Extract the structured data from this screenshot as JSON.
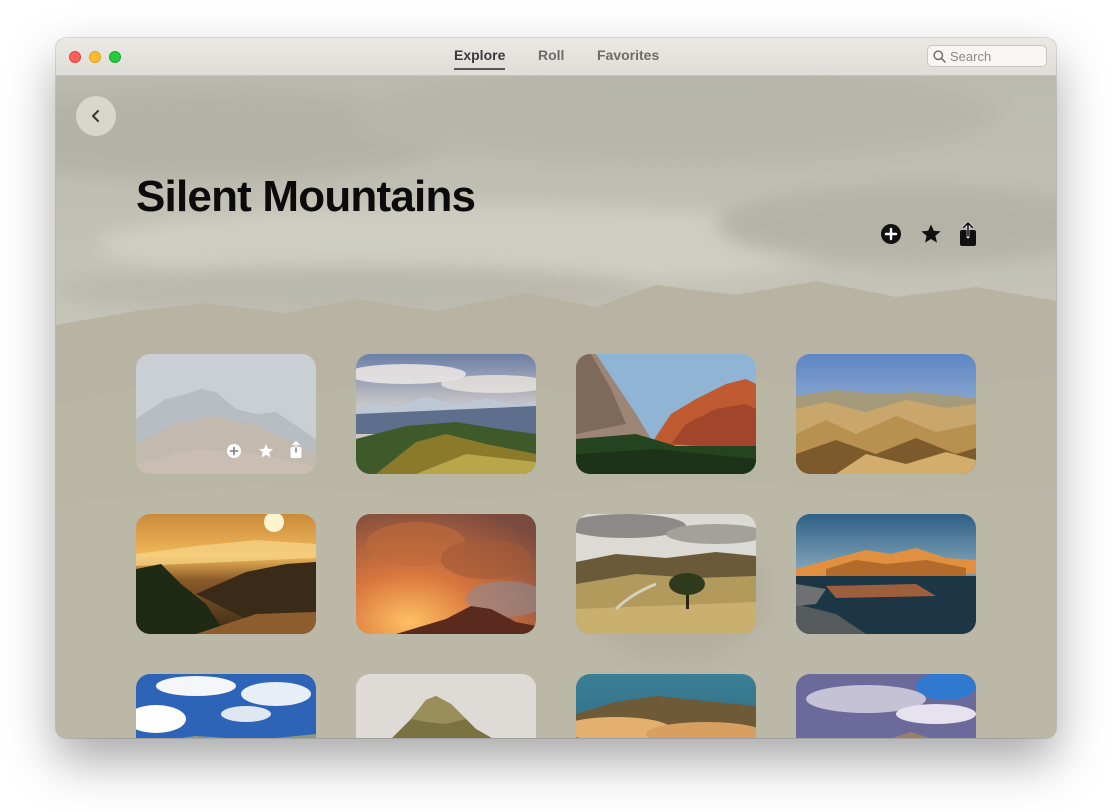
{
  "window": {
    "tabs": [
      {
        "label": "Explore",
        "active": true
      },
      {
        "label": "Roll",
        "active": false
      },
      {
        "label": "Favorites",
        "active": false
      }
    ],
    "search": {
      "placeholder": "Search",
      "value": ""
    }
  },
  "page": {
    "title": "Silent Mountains",
    "actions": [
      {
        "name": "add",
        "icon": "plus-circle-icon"
      },
      {
        "name": "favorite",
        "icon": "star-icon"
      },
      {
        "name": "share",
        "icon": "share-icon"
      }
    ]
  },
  "grid": {
    "hovered_index": 0,
    "hover_actions": [
      "plus-circle-icon",
      "star-icon",
      "share-icon"
    ],
    "items": [
      {
        "scene": "hazy-mountain-ridge"
      },
      {
        "scene": "alpine-forest-cloudy-sky"
      },
      {
        "scene": "red-rock-canyon"
      },
      {
        "scene": "golden-rolling-hills"
      },
      {
        "scene": "sunset-forest-hills"
      },
      {
        "scene": "orange-storm-clouds"
      },
      {
        "scene": "lone-tree-valley-road"
      },
      {
        "scene": "lake-at-golden-peaks"
      },
      {
        "scene": "blue-sky-plains"
      },
      {
        "scene": "green-mountain-peak"
      },
      {
        "scene": "sea-of-clouds"
      },
      {
        "scene": "purple-sky-mountain-range"
      }
    ]
  },
  "colors": {
    "accent_underline": "#555555",
    "traffic_red": "#fe5f57",
    "traffic_yellow": "#febc2e",
    "traffic_green": "#28c840",
    "background_tint": "#c2c0b2"
  }
}
